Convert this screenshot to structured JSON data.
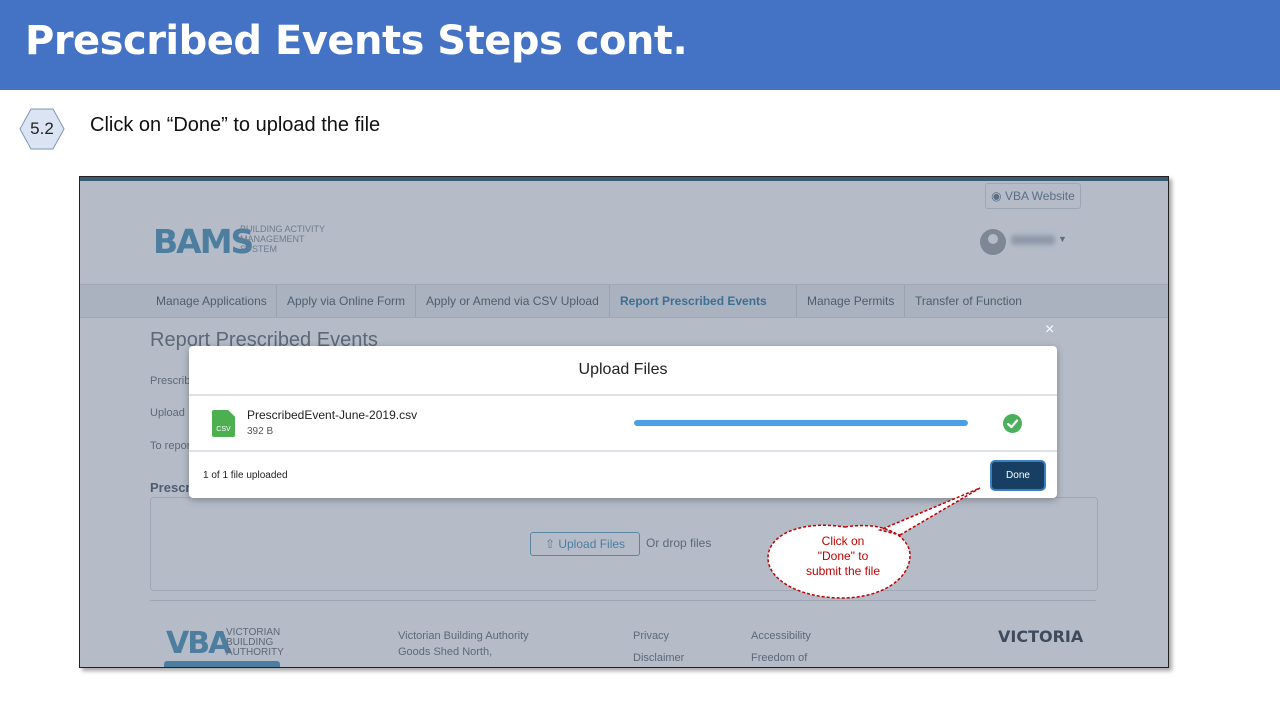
{
  "slide": {
    "title": "Prescribed Events Steps cont.",
    "step_number": "5.2",
    "step_text": "Click on “Done” to upload the file",
    "title_bar_color": "#4472c4"
  },
  "screenshot": {
    "vba_website_link": "VBA Website",
    "logo": {
      "mark": "BAMS",
      "subtitle": "BUILDING ACTIVITY\nMANAGEMENT\nSYSTEM"
    },
    "nav": {
      "items": [
        {
          "label": "Manage Applications",
          "active": false
        },
        {
          "label": "Apply via Online Form",
          "active": false
        },
        {
          "label": "Apply or Amend via CSV Upload",
          "active": false
        },
        {
          "label": "Report Prescribed Events",
          "active": true
        },
        {
          "label": "Manage Permits",
          "active": false
        },
        {
          "label": "Transfer of Function",
          "active": false
        }
      ]
    },
    "page_heading": "Report Prescribed Events",
    "background_lines": [
      "Prescrib",
      "Upload",
      "To repor"
    ],
    "section_heading": "Prescr",
    "upload_files_button": "Upload Files",
    "drop_files_text": "Or drop files",
    "footer": {
      "vba_logo": "VBA",
      "vba_subtitle": "VICTORIAN\nBUILDING\nAUTHORITY",
      "address_lines": [
        "Victorian Building Authority",
        "Goods Shed North,"
      ],
      "links_col1": [
        "Privacy",
        "Disclaimer"
      ],
      "links_col2": [
        "Accessibility",
        "Freedom of"
      ],
      "victoria_logo": "VICTORIA"
    },
    "modal": {
      "title": "Upload Files",
      "file_name": "PrescribedEvent-June-2019.csv",
      "file_size": "392 B",
      "file_type_label": "CSV",
      "progress_fraction": 1.0,
      "status_text": "1 of 1 file uploaded",
      "done_button": "Done",
      "close_symbol": "×"
    },
    "callout_text": "Click on\n\"Done\" to\nsubmit the file"
  }
}
